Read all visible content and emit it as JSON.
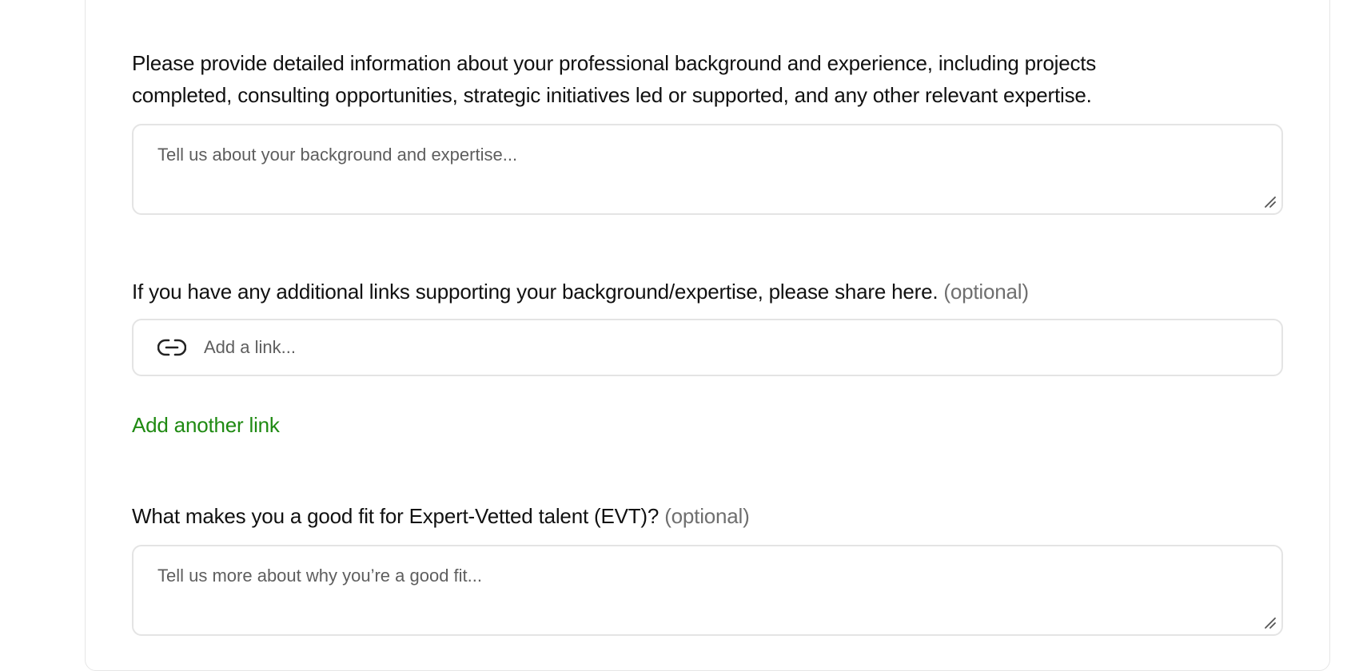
{
  "background_question": {
    "line1": "Please provide detailed information about your professional background and experience, including projects",
    "line2": "completed, consulting opportunities, strategic initiatives led or supported, and any other relevant expertise.",
    "placeholder": "Tell us about your background and expertise..."
  },
  "links_question": {
    "text": "If you have any additional links supporting your background/expertise, please share here.",
    "optional_label": "(optional)",
    "placeholder": "Add a link...",
    "icon": "link-icon",
    "add_another_label": "Add another link"
  },
  "fit_question": {
    "text": "What makes you a good fit for Expert-Vetted talent (EVT)?",
    "optional_label": "(optional)",
    "placeholder": "Tell us more about why you’re a good fit..."
  },
  "colors": {
    "accent_link": "#1f8a12",
    "border": "#e4e4e4",
    "optional_text": "#6f6f6f"
  }
}
